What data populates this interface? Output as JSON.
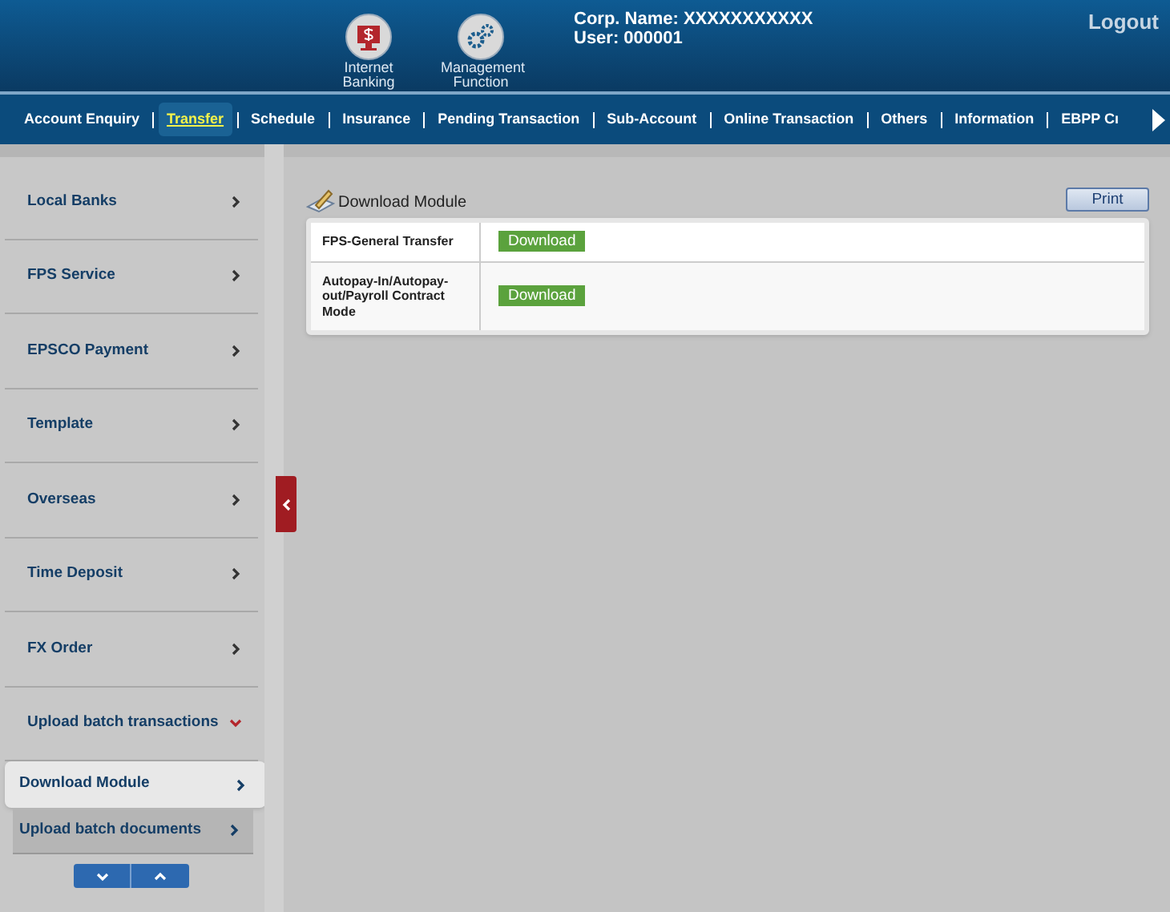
{
  "header": {
    "apps": [
      {
        "label": "Internet Banking",
        "kind": "banking"
      },
      {
        "label": "Management Function",
        "kind": "gears"
      }
    ],
    "corp_name": "Corp. Name: XXXXXXXXXXX",
    "user": "User: 000001",
    "logout": "Logout"
  },
  "nav": {
    "tabs": [
      {
        "label": "Account Enquiry",
        "selected": false
      },
      {
        "label": "Transfer",
        "selected": true
      },
      {
        "label": "Schedule",
        "selected": false
      },
      {
        "label": "Insurance",
        "selected": false
      },
      {
        "label": "Pending Transaction",
        "selected": false
      },
      {
        "label": "Sub-Account",
        "selected": false
      },
      {
        "label": "Online Transaction",
        "selected": false
      },
      {
        "label": "Others",
        "selected": false
      },
      {
        "label": "Information",
        "selected": false
      },
      {
        "label": "EBPP Cı",
        "selected": false
      }
    ]
  },
  "sidebar": {
    "items": [
      {
        "label": "Local Banks",
        "expanded": false
      },
      {
        "label": "FPS Service",
        "expanded": false
      },
      {
        "label": "EPSCO Payment",
        "expanded": false
      },
      {
        "label": "Template",
        "expanded": false
      },
      {
        "label": "Overseas",
        "expanded": false
      },
      {
        "label": "Time Deposit",
        "expanded": false
      },
      {
        "label": "FX Order",
        "expanded": false
      },
      {
        "label": "Upload batch transactions",
        "expanded": true,
        "children": [
          {
            "label": "Download Module",
            "selected": true
          },
          {
            "label": "Upload batch documents",
            "selected": false
          }
        ]
      }
    ]
  },
  "content": {
    "title": "Download Module",
    "print": "Print",
    "rows": [
      {
        "name": "FPS-General Transfer",
        "action": "Download"
      },
      {
        "name": "Autopay-In/Autopay-out/Payroll Contract Mode",
        "action": "Download"
      }
    ]
  }
}
